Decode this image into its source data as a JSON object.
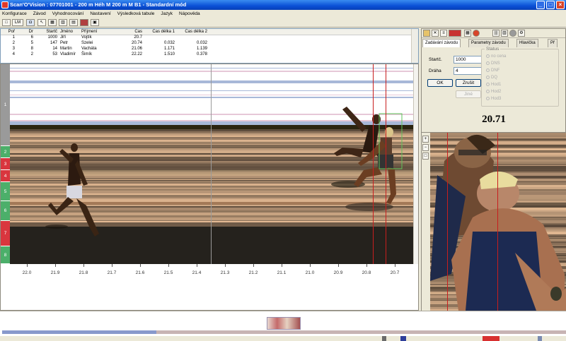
{
  "window": {
    "title": "Scan'O'Vision : 07701001 - 200 m Héh M 200 m  M  B1 - Standardní mód"
  },
  "menu": [
    "Konfigurace",
    "Závod",
    "Vyhodnocování",
    "Nastavení",
    "Výsledková tabule",
    "Jazyk",
    "Nápověda"
  ],
  "toolbar": {
    "lm_label": "LM"
  },
  "results": {
    "columns": [
      "Poř",
      "Dr",
      "Startč",
      "Jméno",
      "Příjmení",
      "Čas",
      "Čas délka 1",
      "Čas délka 2"
    ],
    "rows": [
      [
        "1",
        "6",
        "1000",
        "Jiří",
        "Vojtík",
        "20.7",
        "",
        ""
      ],
      [
        "2",
        "5",
        "147",
        "Petr",
        "Szelei",
        "20.74",
        "0.032",
        "0.032"
      ],
      [
        "3",
        "8",
        "14",
        "Martin",
        "Vacháta",
        "21.06",
        "1.171",
        "1.139"
      ],
      [
        "4",
        "2",
        "53",
        "Vladimír",
        "Šimík",
        "22.22",
        "1.510",
        "0.378"
      ]
    ]
  },
  "lanes": [
    "1",
    "2",
    "3",
    "4",
    "5",
    "6",
    "7",
    "8"
  ],
  "axis_labels": [
    "22.0",
    "21.9",
    "21.8",
    "21.7",
    "21.6",
    "21.5",
    "21.4",
    "21.3",
    "21.2",
    "21.1",
    "21.0",
    "20.9",
    "20.8",
    "20.7"
  ],
  "right_panel": {
    "tabs": [
      "Zadávání závodu",
      "Parametry závodu",
      "Hlavička",
      "Př"
    ],
    "form": {
      "startc_label": "Startč.",
      "startc_value": "1000",
      "draha_label": "Dráha",
      "draha_value": "4",
      "ok_label": "OK",
      "cancel_label": "Zrušit",
      "other_label": "Jiné"
    },
    "status": {
      "label": "Status",
      "options": [
        "no cena",
        "DNS",
        "DNF",
        "DQ",
        "Hod1",
        "Hod2",
        "Hod3"
      ]
    },
    "time_display": "20.71"
  },
  "colors": {
    "titlebar": "#0a4fd6",
    "lane_green": "#4caf6a",
    "lane_red": "#d9363e",
    "lane_gray": "#9a9a9a",
    "finish_line": "#c81e1e"
  }
}
